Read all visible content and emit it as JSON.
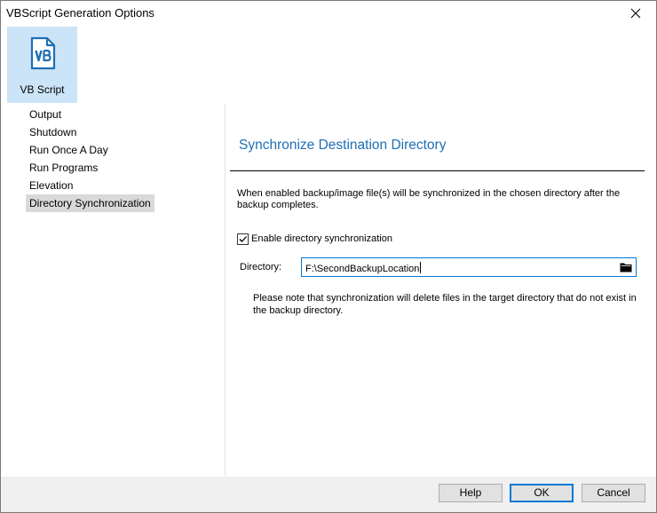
{
  "window": {
    "title": "VBScript Generation Options"
  },
  "toolbar": {
    "items": [
      {
        "label": "VB Script",
        "icon": "vb-script-file-icon",
        "selected": true
      }
    ]
  },
  "nav": {
    "items": [
      {
        "label": "Output"
      },
      {
        "label": "Shutdown"
      },
      {
        "label": "Run Once A Day"
      },
      {
        "label": "Run Programs"
      },
      {
        "label": "Elevation"
      },
      {
        "label": "Directory Synchronization",
        "selected": true
      }
    ]
  },
  "content": {
    "title": "Synchronize Destination Directory",
    "description": "When enabled backup/image file(s) will be synchronized in the chosen directory after the backup completes.",
    "enable_checkbox": {
      "label": "Enable directory synchronization",
      "checked": true
    },
    "directory": {
      "label": "Directory:",
      "value": "F:\\SecondBackupLocation"
    },
    "note": "Please note that synchronization will delete files in the target directory that do not exist in the backup directory."
  },
  "footer": {
    "help_label": "Help",
    "ok_label": "OK",
    "cancel_label": "Cancel"
  },
  "colors": {
    "accent": "#0078d7",
    "title_blue": "#1f6fb5",
    "selected_toolbar_bg": "#cce4f7",
    "selected_nav_bg": "#d9d9d9"
  }
}
